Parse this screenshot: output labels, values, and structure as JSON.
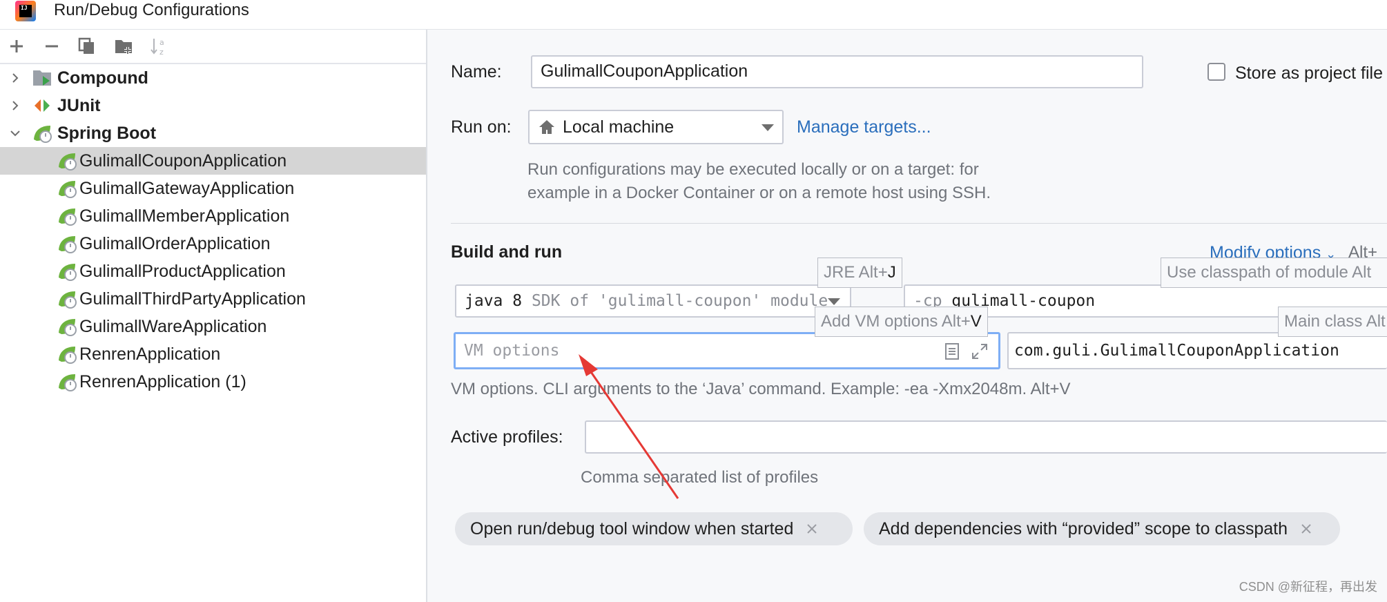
{
  "window": {
    "title": "Run/Debug Configurations"
  },
  "toolbar": {
    "add": "add-config",
    "remove": "remove-config",
    "copy": "copy-config",
    "folder": "new-folder",
    "sort": "sort-configs"
  },
  "tree": {
    "groups": [
      {
        "label": "Compound",
        "expanded": false
      },
      {
        "label": "JUnit",
        "expanded": false
      },
      {
        "label": "Spring Boot",
        "expanded": true
      }
    ],
    "items": [
      "GulimallCouponApplication",
      "GulimallGatewayApplication",
      "GulimallMemberApplication",
      "GulimallOrderApplication",
      "GulimallProductApplication",
      "GulimallThirdPartyApplication",
      "GulimallWareApplication",
      "RenrenApplication",
      "RenrenApplication (1)"
    ]
  },
  "form": {
    "name_label": "Name:",
    "name_value": "GulimallCouponApplication",
    "store_label": "Store as project file",
    "run_on_label": "Run on:",
    "run_on_value": "Local machine",
    "manage_targets": "Manage targets...",
    "run_on_hint_1": "Run configurations may be executed locally or on a target: for",
    "run_on_hint_2": "example in a Docker Container or on a remote host using SSH.",
    "build_title": "Build and run",
    "modify_options": "Modify options",
    "modify_shortcut": "Alt+",
    "jre_tooltip_text": "JRE Alt+",
    "jre_tooltip_key": "J",
    "classpath_tooltip": "Use classpath of module Alt",
    "sdk_prefix": "java 8",
    "sdk_detail": "SDK of 'gulimall-coupon' module",
    "cp_prefix": "-cp",
    "cp_value": "gulimall-coupon",
    "vm_tooltip_text": "Add VM options Alt+",
    "vm_tooltip_key": "V",
    "mainclass_tooltip": "Main class Alt",
    "vm_placeholder": "VM options",
    "main_class_value": "com.guli.GulimallCouponApplication",
    "vm_hint": "VM options. CLI arguments to the ‘Java’ command. Example: -ea -Xmx2048m. Alt+V",
    "profiles_label": "Active profiles:",
    "profiles_hint": "Comma separated list of profiles",
    "chip1": "Open run/debug tool window when started",
    "chip2": "Add dependencies with “provided” scope to classpath"
  },
  "watermark": "CSDN @新征程，再出发",
  "colors": {
    "accent": "#2a6ebc",
    "selection": "#d5d5d5",
    "focus": "#7eaef5",
    "arrow": "#e53935",
    "spring": "#6db33f"
  }
}
